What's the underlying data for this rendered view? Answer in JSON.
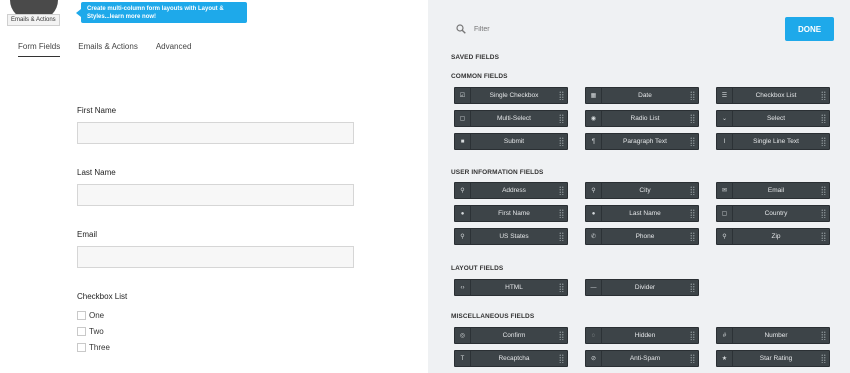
{
  "promo": {
    "mascot_tag": "Emails & Actions",
    "text": "Create multi-column form layouts with Layout & Styles...learn more now!"
  },
  "tabs": [
    "Form Fields",
    "Emails & Actions",
    "Advanced"
  ],
  "form": {
    "fields": [
      {
        "label": "First Name"
      },
      {
        "label": "Last Name"
      },
      {
        "label": "Email"
      }
    ],
    "checkbox_list": {
      "label": "Checkbox List",
      "options": [
        "One",
        "Two",
        "Three"
      ]
    }
  },
  "right": {
    "filter_placeholder": "Filter",
    "done_label": "DONE",
    "saved_title": "SAVED FIELDS",
    "sections": [
      {
        "title": "COMMON FIELDS",
        "items": [
          {
            "label": "Single Checkbox",
            "icon": "☑"
          },
          {
            "label": "Date",
            "icon": "▦"
          },
          {
            "label": "Checkbox List",
            "icon": "☰"
          },
          {
            "label": "Multi-Select",
            "icon": "▢"
          },
          {
            "label": "Radio List",
            "icon": "◉"
          },
          {
            "label": "Select",
            "icon": "⌄"
          },
          {
            "label": "Submit",
            "icon": "■"
          },
          {
            "label": "Paragraph Text",
            "icon": "¶"
          },
          {
            "label": "Single Line Text",
            "icon": "I"
          }
        ]
      },
      {
        "title": "USER INFORMATION FIELDS",
        "items": [
          {
            "label": "Address",
            "icon": "⚲"
          },
          {
            "label": "City",
            "icon": "⚲"
          },
          {
            "label": "Email",
            "icon": "✉"
          },
          {
            "label": "First Name",
            "icon": "●"
          },
          {
            "label": "Last Name",
            "icon": "●"
          },
          {
            "label": "Country",
            "icon": "▢"
          },
          {
            "label": "US States",
            "icon": "⚲"
          },
          {
            "label": "Phone",
            "icon": "✆"
          },
          {
            "label": "Zip",
            "icon": "⚲"
          }
        ]
      },
      {
        "title": "LAYOUT FIELDS",
        "items": [
          {
            "label": "HTML",
            "icon": "‹›"
          },
          {
            "label": "Divider",
            "icon": "—"
          }
        ]
      },
      {
        "title": "MISCELLANEOUS FIELDS",
        "items": [
          {
            "label": "Confirm",
            "icon": "◎"
          },
          {
            "label": "Hidden",
            "icon": "◌"
          },
          {
            "label": "Number",
            "icon": "#"
          },
          {
            "label": "Recaptcha",
            "icon": "T"
          },
          {
            "label": "Anti-Spam",
            "icon": "⊘"
          },
          {
            "label": "Star Rating",
            "icon": "★"
          }
        ]
      }
    ]
  }
}
